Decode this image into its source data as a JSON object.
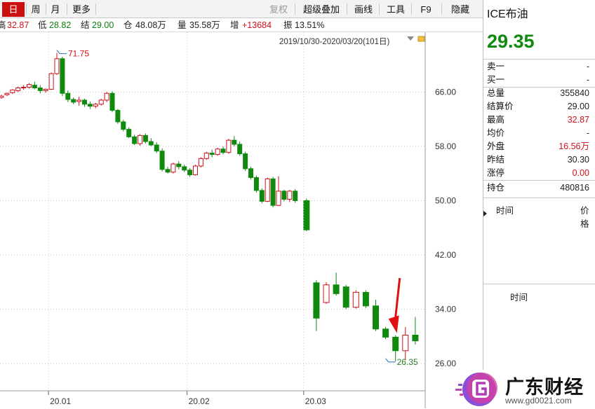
{
  "toolbar": {
    "items": [
      "日",
      "周",
      "月",
      "更多",
      "复权",
      "超级叠加",
      "画线",
      "工具",
      "F9",
      "隐藏"
    ],
    "active": "日",
    "disabled": "复权"
  },
  "infobar": {
    "high_label": "高",
    "high": "32.87",
    "low_label": "低",
    "low": "28.82",
    "settle_label": "结",
    "settle": "29.00",
    "oi_label": "仓",
    "oi": "48.08万",
    "vol_label": "量",
    "vol": "35.58万",
    "inc_label": "增",
    "inc": "+13684",
    "amp_label": "振",
    "amp": "13.51%"
  },
  "chart_range": "2019/10/30-2020/03/20(101日)",
  "chart_data": {
    "type": "candlestick",
    "y_ticks": [
      66.0,
      58.0,
      50.0,
      42.0,
      34.0,
      26.0
    ],
    "x_ticks": [
      "20.01",
      "20.02",
      "20.03"
    ],
    "ylim": [
      22,
      74.8
    ],
    "annotations": [
      {
        "label": "71.75",
        "value": 71.75,
        "note": "max"
      },
      {
        "label": "26.35",
        "value": 26.35,
        "note": "min"
      }
    ],
    "candles": [
      [
        65.2,
        65.6,
        65.0,
        65.4
      ],
      [
        65.6,
        65.9,
        65.4,
        65.8
      ],
      [
        65.9,
        66.4,
        65.7,
        66.3
      ],
      [
        66.2,
        66.8,
        66.0,
        66.6
      ],
      [
        66.6,
        67.0,
        66.3,
        66.7
      ],
      [
        66.7,
        67.3,
        66.5,
        67.1
      ],
      [
        67.0,
        67.5,
        66.4,
        66.6
      ],
      [
        66.6,
        67.0,
        65.8,
        66.2
      ],
      [
        66.2,
        66.5,
        65.9,
        66.4
      ],
      [
        66.4,
        68.9,
        66.3,
        68.7
      ],
      [
        68.7,
        71.75,
        68.5,
        70.9
      ],
      [
        70.9,
        71.2,
        65.4,
        65.8
      ],
      [
        65.8,
        66.2,
        64.5,
        64.9
      ],
      [
        64.9,
        65.2,
        64.2,
        64.5
      ],
      [
        64.6,
        65.3,
        64.0,
        64.8
      ],
      [
        64.8,
        65.0,
        63.8,
        64.2
      ],
      [
        64.2,
        64.6,
        63.5,
        63.9
      ],
      [
        63.9,
        64.4,
        63.6,
        64.2
      ],
      [
        64.2,
        65.0,
        64.0,
        64.8
      ],
      [
        64.8,
        66.0,
        64.5,
        65.8
      ],
      [
        65.8,
        66.1,
        63.0,
        63.3
      ],
      [
        63.3,
        63.5,
        61.3,
        61.6
      ],
      [
        61.6,
        61.9,
        60.2,
        60.5
      ],
      [
        60.5,
        60.8,
        59.2,
        59.4
      ],
      [
        59.4,
        59.7,
        58.2,
        58.4
      ],
      [
        58.4,
        59.8,
        58.1,
        59.6
      ],
      [
        59.6,
        59.9,
        58.4,
        58.7
      ],
      [
        58.7,
        59.2,
        58.0,
        58.2
      ],
      [
        58.2,
        58.6,
        57.0,
        57.3
      ],
      [
        57.3,
        57.7,
        54.3,
        54.6
      ],
      [
        54.6,
        55.0,
        54.0,
        54.2
      ],
      [
        54.2,
        55.6,
        54.0,
        55.4
      ],
      [
        55.4,
        55.8,
        54.6,
        55.0
      ],
      [
        55.0,
        55.3,
        54.2,
        54.5
      ],
      [
        54.5,
        54.8,
        53.5,
        53.8
      ],
      [
        53.8,
        55.3,
        53.7,
        55.1
      ],
      [
        55.1,
        56.4,
        54.9,
        56.2
      ],
      [
        56.2,
        57.2,
        56.0,
        57.0
      ],
      [
        57.0,
        57.5,
        56.4,
        56.8
      ],
      [
        56.8,
        57.8,
        56.6,
        57.6
      ],
      [
        57.6,
        58.0,
        56.8,
        57.1
      ],
      [
        57.1,
        59.1,
        56.9,
        58.9
      ],
      [
        58.9,
        59.5,
        58.0,
        58.3
      ],
      [
        58.3,
        58.7,
        56.6,
        56.9
      ],
      [
        56.9,
        57.2,
        54.4,
        54.7
      ],
      [
        54.7,
        55.0,
        53.1,
        53.4
      ],
      [
        53.4,
        53.7,
        51.2,
        51.5
      ],
      [
        51.5,
        51.8,
        49.6,
        49.9
      ],
      [
        49.9,
        53.4,
        49.8,
        53.2
      ],
      [
        53.2,
        53.5,
        49.0,
        49.3
      ],
      [
        49.3,
        53.6,
        49.2,
        51.4
      ],
      [
        51.4,
        51.6,
        49.9,
        50.2
      ],
      [
        50.2,
        51.6,
        49.8,
        51.4
      ],
      [
        51.4,
        51.7,
        49.7,
        50.0
      ],
      [
        50.0,
        50.3,
        45.5,
        45.7
      ],
      [
        37.9,
        38.3,
        30.8,
        32.7
      ],
      [
        35.0,
        38.0,
        34.8,
        37.6
      ],
      [
        37.6,
        39.4,
        36.0,
        36.3
      ],
      [
        37.3,
        37.6,
        34.0,
        34.3
      ],
      [
        34.3,
        36.8,
        34.1,
        36.5
      ],
      [
        36.5,
        36.8,
        34.2,
        34.5
      ],
      [
        34.5,
        35.4,
        30.8,
        31.1
      ],
      [
        31.1,
        31.4,
        29.6,
        29.9
      ],
      [
        29.9,
        30.2,
        26.35,
        27.9
      ],
      [
        27.9,
        31.4,
        26.5,
        30.2
      ],
      [
        30.2,
        32.87,
        28.82,
        29.35
      ]
    ]
  },
  "quote": {
    "name": "ICE布油",
    "price": "29.35",
    "rows": [
      {
        "label": "卖一",
        "value": "-",
        "color": "#222"
      },
      {
        "label": "买一",
        "value": "-",
        "color": "#222"
      },
      {
        "label": "总量",
        "value": "355840",
        "color": "#222"
      },
      {
        "label": "结算价",
        "value": "29.00",
        "color": "#222"
      },
      {
        "label": "最高",
        "value": "32.87",
        "color": "#d0101a"
      },
      {
        "label": "均价",
        "value": "-",
        "color": "#222"
      },
      {
        "label": "外盘",
        "value": "16.56万",
        "color": "#d0101a"
      },
      {
        "label": "昨结",
        "value": "30.30",
        "color": "#222"
      },
      {
        "label": "涨停",
        "value": "0.00",
        "color": "#d0101a"
      },
      {
        "label": "持仓",
        "value": "480816",
        "color": "#222"
      }
    ],
    "time_header": "时间",
    "price_header": "价格",
    "time_header2": "时间"
  },
  "watermark": {
    "name": "广东财经",
    "url": "www.gd0021.com",
    "icon": "logo-g-icon"
  },
  "colors": {
    "up": "#d0101a",
    "down": "#0f8a0f",
    "grid": "#c8c8c8"
  }
}
